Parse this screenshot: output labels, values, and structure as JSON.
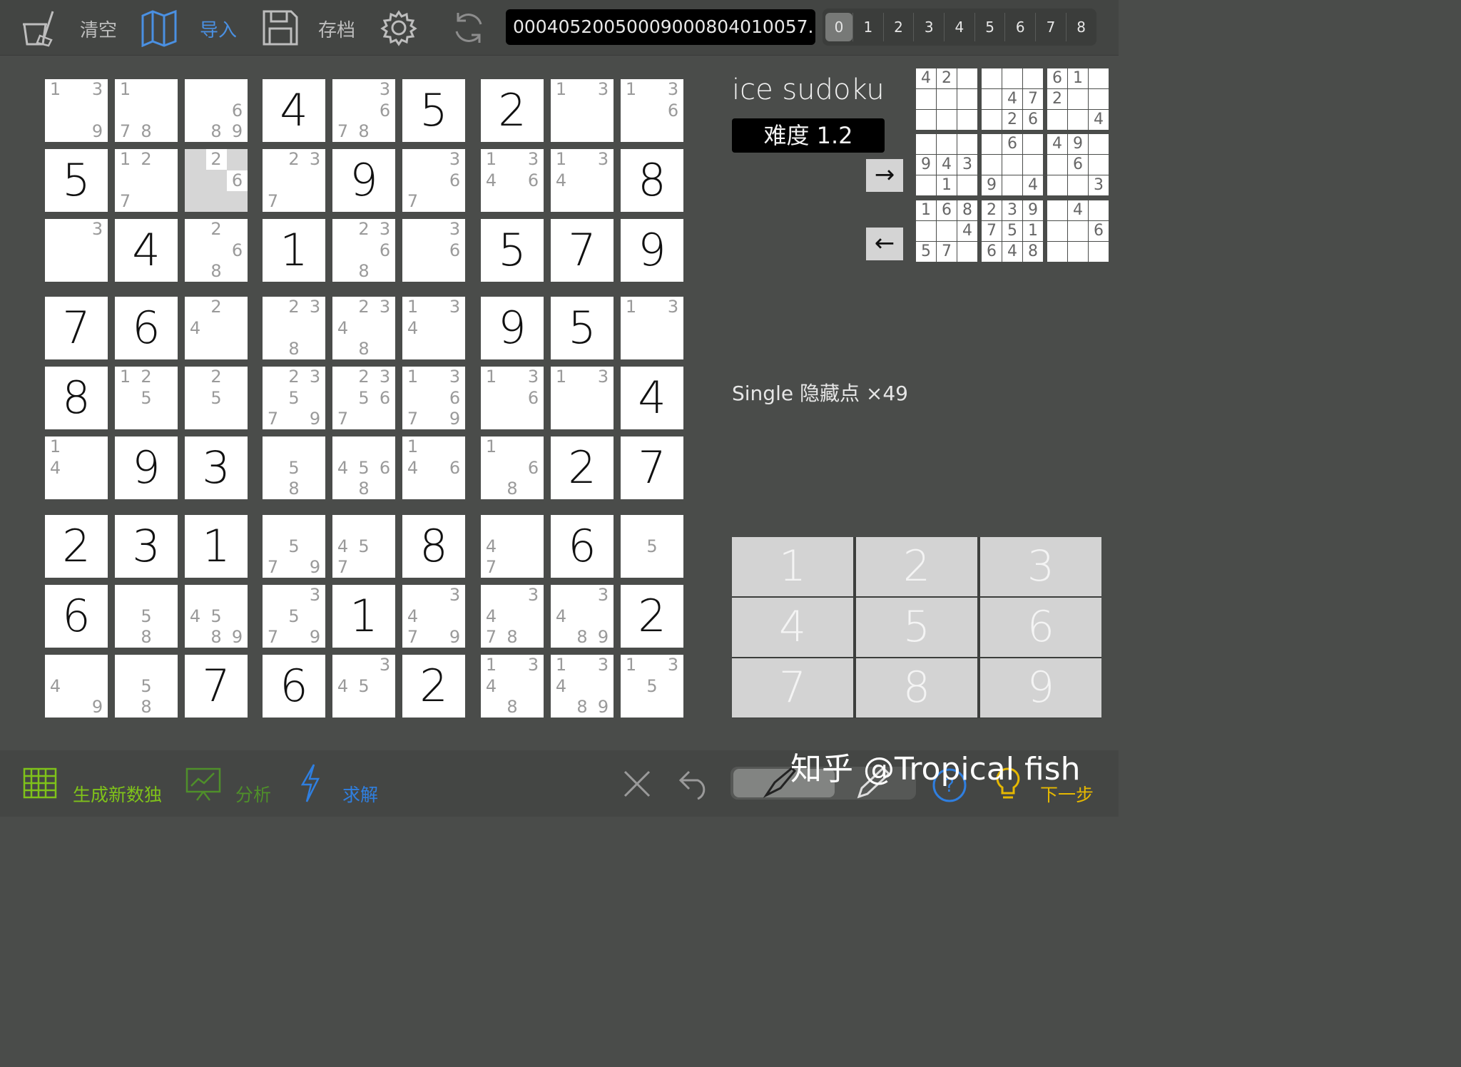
{
  "toolbar": {
    "clear_label": "清空",
    "import_label": "导入",
    "save_label": "存档",
    "puzzle_code": "0004052005000900080401005​7...",
    "steps": [
      "0",
      "1",
      "2",
      "3",
      "4",
      "5",
      "6",
      "7",
      "8"
    ],
    "active_step": "0"
  },
  "grid": {
    "cells": [
      [
        "c:1,3,9",
        "c:1,7,8",
        "c:6,8,9",
        "4",
        "c:3,6,7,8",
        "5",
        "2",
        "c:1,3",
        "c:1,3,6"
      ],
      [
        "5",
        "c:1,2,7",
        "h:2,6",
        "c:2,3,7",
        "9",
        "c:3,6,7",
        "c:1,3,4,6",
        "c:1,3,4",
        "8"
      ],
      [
        "c:3",
        "4",
        "c:2,6,8",
        "1",
        "c:2,3,6,8",
        "c:3,6",
        "5",
        "7",
        "9"
      ],
      [
        "7",
        "6",
        "c:2,4",
        "c:2,3,8",
        "c:2,3,4,8",
        "c:1,3,4",
        "9",
        "5",
        "c:1,3"
      ],
      [
        "8",
        "c:1,2,5",
        "c:2,5",
        "c:2,3,5,7,9",
        "c:2,3,5,6,7",
        "c:1,3,6,7,9",
        "c:1,3,6",
        "c:1,3",
        "4"
      ],
      [
        "c:1,4",
        "9",
        "3",
        "c:5,8",
        "c:4,5,6,8",
        "c:1,4,6",
        "c:1,6,8",
        "2",
        "7"
      ],
      [
        "2",
        "3",
        "1",
        "c:5,7,9",
        "c:4,5,7",
        "8",
        "c:4,7",
        "6",
        "c:5"
      ],
      [
        "6",
        "c:5,8",
        "c:4,5,8,9",
        "c:3,5,7,9",
        "1",
        "c:3,4,7,9",
        "c:3,4,7,8",
        "c:3,4,8,9",
        "2"
      ],
      [
        "c:4,9",
        "c:5,8",
        "7",
        "6",
        "c:3,4,5",
        "2",
        "c:1,3,4,8",
        "c:1,3,4,8,9",
        "c:1,3,5"
      ]
    ]
  },
  "panel": {
    "app_title": "ice sudoku",
    "difficulty": "难度 1.2",
    "next_arrow": "→",
    "prev_arrow": "←",
    "technique": "Single 隐藏点 ×49",
    "mini_grid": [
      [
        "4",
        "2",
        "",
        "",
        "",
        "",
        "6",
        "1",
        ""
      ],
      [
        "",
        "",
        "",
        "",
        "4",
        "7",
        "2",
        "",
        ""
      ],
      [
        "",
        "",
        "",
        "",
        "2",
        "6",
        "",
        "",
        "4"
      ],
      [
        "",
        "",
        "",
        "",
        "6",
        "",
        "4",
        "9",
        ""
      ],
      [
        "9",
        "4",
        "3",
        "",
        "",
        "",
        "",
        "6",
        ""
      ],
      [
        "",
        "1",
        "",
        "9",
        "",
        "4",
        "",
        "",
        "3"
      ],
      [
        "1",
        "6",
        "8",
        "2",
        "3",
        "9",
        "",
        "4",
        ""
      ],
      [
        "",
        "",
        "4",
        "7",
        "5",
        "1",
        "",
        "",
        "6"
      ],
      [
        "5",
        "7",
        "",
        "6",
        "4",
        "8",
        "",
        "",
        ""
      ]
    ],
    "numpad": [
      "1",
      "2",
      "3",
      "4",
      "5",
      "6",
      "7",
      "8",
      "9"
    ]
  },
  "bottom": {
    "generate_label": "生成新数独",
    "analyze_label": "分析",
    "solve_label": "求解",
    "next_step_label": "下一步",
    "colors": {
      "generate": "#7fc21a",
      "analyze": "#4f8f2a",
      "solve": "#2f7fe0",
      "next": "#e6b800"
    }
  },
  "watermark": "知乎 @Tropical fish"
}
